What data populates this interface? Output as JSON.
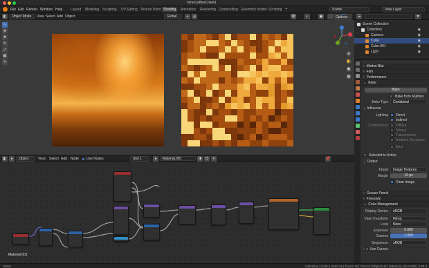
{
  "window": {
    "title": "minecrafttest.blend"
  },
  "menu": [
    "File",
    "Edit",
    "Render",
    "Window",
    "Help"
  ],
  "workspaces": [
    "Layout",
    "Modeling",
    "Sculpting",
    "UV Editing",
    "Texture Paint",
    "Shading",
    "Animation",
    "Rendering",
    "Compositing",
    "Geometry Nodes",
    "Scripting"
  ],
  "active_workspace": "Shading",
  "scene": "Scene",
  "view_layer": "View Layer",
  "viewport": {
    "mode": "Object Mode",
    "menus": [
      "View",
      "Select",
      "Add",
      "Object"
    ],
    "orientation": "Global",
    "options": "Options"
  },
  "node_editor": {
    "type": "Object",
    "menus": [
      "View",
      "Select",
      "Add",
      "Node"
    ],
    "use_nodes": "Use Nodes",
    "slot": "Slot 1",
    "material": "Material.001",
    "material_label": "Material.001"
  },
  "outliner": [
    {
      "label": "Scene Collection",
      "icon": "collection-icon"
    },
    {
      "label": "Collection",
      "icon": "collection-icon"
    },
    {
      "label": "Camera",
      "icon": "camera-icon"
    },
    {
      "label": "Cube",
      "icon": "mesh-icon",
      "selected": true
    },
    {
      "label": "Cube.001",
      "icon": "mesh-icon"
    },
    {
      "label": "Light",
      "icon": "light-icon"
    }
  ],
  "properties": {
    "sections_top": [
      "Motion Blur",
      "Film",
      "Performance"
    ],
    "bake_section": "Bake",
    "bake_button": "Bake",
    "bake_from_multires": "Bake from Multires",
    "bake_type_label": "Bake Type",
    "bake_type": "Combined",
    "influence": "Influence",
    "lighting_label": "Lighting",
    "direct": "Direct",
    "indirect": "Indirect",
    "contributions_label": "Contributions",
    "diffuse": "Diffuse",
    "glossy": "Glossy",
    "transmission": "Transmission",
    "ambient_occlusion": "Ambient Occlusion",
    "emit": "Emit",
    "selected_to_active": "Selected to Active",
    "output": "Output",
    "target_label": "Target",
    "target": "Image Textures",
    "margin_label": "Margin",
    "margin": "16 px",
    "clear_image": "Clear Image",
    "sections_mid": [
      "Grease Pencil",
      "Freestyle",
      "Color Management"
    ],
    "display_device_label": "Display Device",
    "display_device": "sRGB",
    "view_transform_label": "View Transform",
    "view_transform": "Filmic",
    "look_label": "Look",
    "look": "None",
    "exposure_label": "Exposure",
    "exposure": "0.000",
    "gamma_label": "Gamma",
    "gamma": "1.000",
    "sequencer_label": "Sequencer",
    "sequencer": "sRGB",
    "use_curves": "Use Curves"
  },
  "status": {
    "left": "Select",
    "right": "Collection | Cube | Verts:16 | Faces:12 | Tris:24 | Objects:1/4 | Memory: 52.9 MiB | 2.93.0"
  },
  "colors": {
    "selected_row": "#334d80",
    "accent": "#4772b3",
    "node_header_purple": "#6a4fa3",
    "node_header_blue": "#2e62a6",
    "node_header_red": "#9b2f2f",
    "node_header_green": "#2a8a3c",
    "node_header_orange": "#b0622a"
  }
}
